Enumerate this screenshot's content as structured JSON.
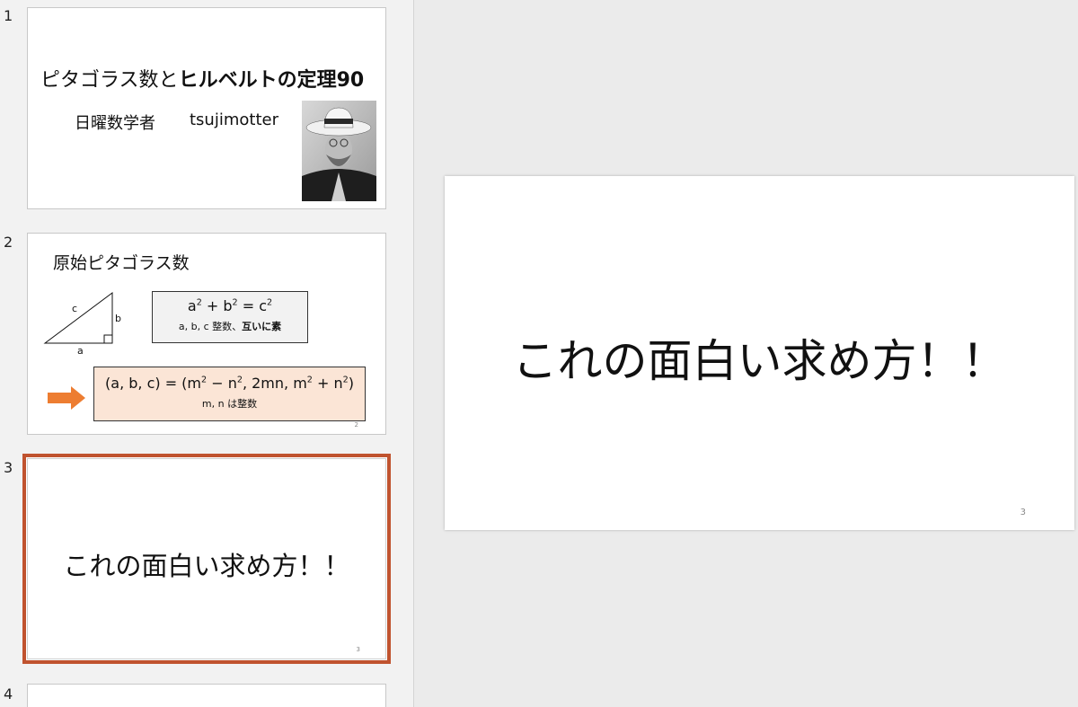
{
  "slides": [
    {
      "number": "1",
      "title_normal": "ピタゴラス数と",
      "title_bold": "ヒルベルトの定理90",
      "author_label": "日曜数学者",
      "author_name": "tsujimotter",
      "photo": "portrait-photo"
    },
    {
      "number": "2",
      "title": "原始ピタゴラス数",
      "triangle_labels": {
        "a": "a",
        "b": "b",
        "c": "c"
      },
      "equation": {
        "a": "a",
        "b": "b",
        "c": "c",
        "exp": "2",
        "plus": " + ",
        "equals": " = "
      },
      "equation_note": "a, b, c 整数、",
      "equation_note_bold": "互いに素",
      "formula": {
        "lhs": "(a, b, c) = (m",
        "part2": " − n",
        "part3": ", 2mn, m",
        "part4": " + n",
        "end": ")",
        "exp": "2"
      },
      "formula_note": "m, n は整数",
      "page": "2"
    },
    {
      "number": "3",
      "text": "これの面白い求め方！！",
      "page": "3",
      "selected": true
    },
    {
      "number": "4"
    }
  ],
  "main_slide": {
    "text": "これの面白い求め方！！",
    "page": "3"
  },
  "colors": {
    "selection": "#c0532f",
    "arrow": "#ed7d31",
    "formula_bg": "#fbe5d6",
    "equation_bg": "#f2f2f2"
  }
}
